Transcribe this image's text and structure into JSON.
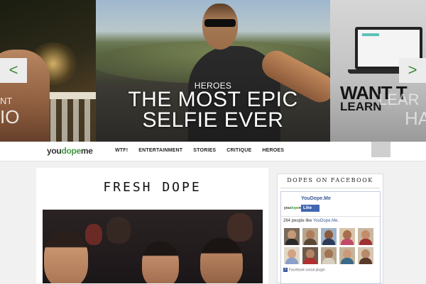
{
  "carousel": {
    "prev_arrow": "<",
    "next_arrow": ">",
    "left_slide": {
      "partial_line1": "NT",
      "partial_line2": "IO"
    },
    "center_slide": {
      "category": "HEROES",
      "title_line1": "THE MOST EPIC",
      "title_line2": "SELFIE EVER"
    },
    "right_slide": {
      "line1": "WANT T",
      "line2": "LEARN",
      "ghost1": "LEAR",
      "ghost2": "HAR"
    }
  },
  "header": {
    "logo_part1": "you",
    "logo_part2": "dope",
    "logo_part3": "me",
    "nav": [
      "WTF!",
      "ENTERTAINMENT",
      "STORIES",
      "CRITIQUE",
      "HEROES"
    ]
  },
  "main": {
    "section_title": "FRESH DOPE"
  },
  "sidebar": {
    "title": "DOPES ON FACEBOOK",
    "fb": {
      "page_name": "YouDope.Me",
      "like_label": "Like",
      "logo_part1": "you",
      "logo_part2": "dope",
      "logo_part3": "me",
      "count_prefix": "264 people like ",
      "count_link": "YouDope.Me",
      "count_suffix": ".",
      "plugin_label": "Facebook social plugin",
      "plugin_icon": "f"
    }
  },
  "colors": {
    "brand_green": "#3f9b3f",
    "facebook_blue": "#3b5998"
  }
}
